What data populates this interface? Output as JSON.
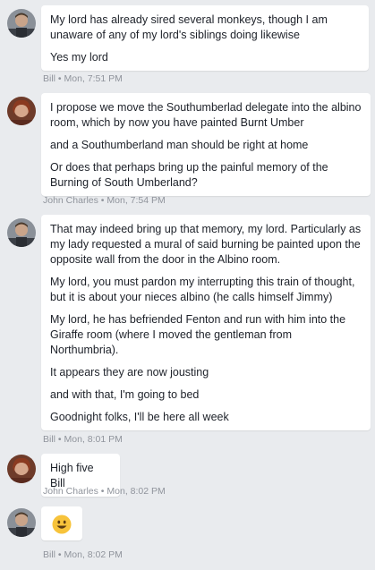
{
  "messages": [
    {
      "author": "Bill",
      "time": "Mon, 7:51 PM",
      "lines": [
        "My lord has already sired several monkeys, though I am unaware of any of my lord's siblings doing likewise",
        "Yes my lord"
      ]
    },
    {
      "author": "John Charles",
      "time": "Mon, 7:54 PM",
      "lines": [
        "I propose we move the Southumberlad delegate into the albino room, which by now you have painted Burnt Umber",
        "and a Southumberland man should be right at home",
        "Or does that perhaps bring up the painful memory of the Burning of South Umberland?"
      ]
    },
    {
      "author": "Bill",
      "time": "Mon, 8:01 PM",
      "lines": [
        "That may indeed bring up that memory, my lord. Particularly as my lady requested a mural of said burning be painted upon the opposite wall from the door in the Albino room.",
        "My lord, you must pardon my interrupting this train of thought, but it is about your nieces albino (he calls himself Jimmy)",
        "My lord, he has befriended Fenton and run with him into the Giraffe room (where I moved the gentleman from Northumbria).",
        "It appears they are now jousting",
        "and with that, I'm going to bed",
        "Goodnight folks, I'll be here all week"
      ]
    },
    {
      "author": "John Charles",
      "time": "Mon, 8:02 PM",
      "lines": [
        "High five Bill"
      ]
    },
    {
      "author": "Bill",
      "time": "Mon, 8:02 PM",
      "emoji": "smiley-emoji"
    }
  ],
  "separator": " • "
}
